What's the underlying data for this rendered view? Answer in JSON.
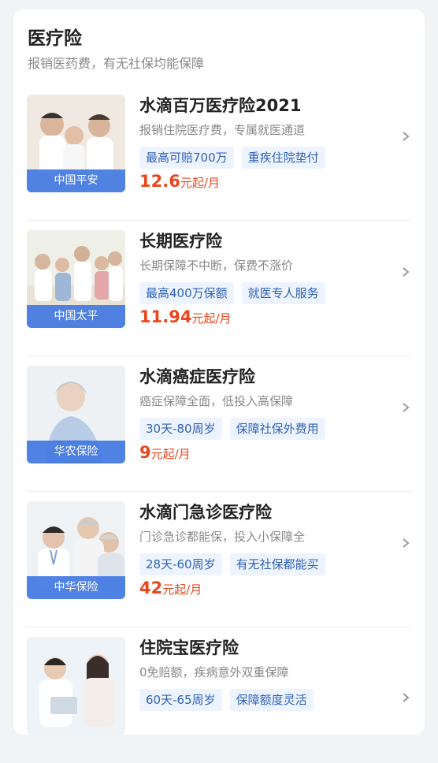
{
  "section": {
    "title": "医疗险",
    "subtitle": "报销医药费，有无社保均能保障"
  },
  "products": [
    {
      "name": "水滴百万医疗险2021",
      "desc": "报销住院医疗费，专属就医通道",
      "tags": [
        "最高可赔700万",
        "重疾住院垫付"
      ],
      "price": "12.6",
      "unit": "元起/月",
      "brand": "中国平安",
      "icon": "family-photo"
    },
    {
      "name": "长期医疗险",
      "desc": "长期保障不中断，保费不涨价",
      "tags": [
        "最高400万保额",
        "就医专人服务"
      ],
      "price": "11.94",
      "unit": "元起/月",
      "brand": "中国太平",
      "icon": "family-on-sofa-photo"
    },
    {
      "name": "水滴癌症医疗险",
      "desc": "癌症保障全面，低投入高保障",
      "tags": [
        "30天-80周岁",
        "保障社保外费用"
      ],
      "price": "9",
      "unit": "元起/月",
      "brand": "华农保险",
      "icon": "elderly-woman-photo"
    },
    {
      "name": "水滴门急诊医疗险",
      "desc": "门诊急诊都能保，投入小保障全",
      "tags": [
        "28天-60周岁",
        "有无社保都能买"
      ],
      "price": "42",
      "unit": "元起/月",
      "brand": "中华保险",
      "icon": "doctor-elderly-couple-photo"
    },
    {
      "name": "住院宝医疗险",
      "desc": "0免赔额，疾病意外双重保障",
      "tags": [
        "60天-65周岁",
        "保障额度灵活"
      ],
      "price": "",
      "unit": "",
      "brand": "",
      "icon": "doctor-patient-photo"
    }
  ],
  "colors": {
    "price": "#e8461e",
    "tag_text": "#2f62b8",
    "tag_bg": "#eef4ff",
    "brand_bar": "#4278e2"
  }
}
